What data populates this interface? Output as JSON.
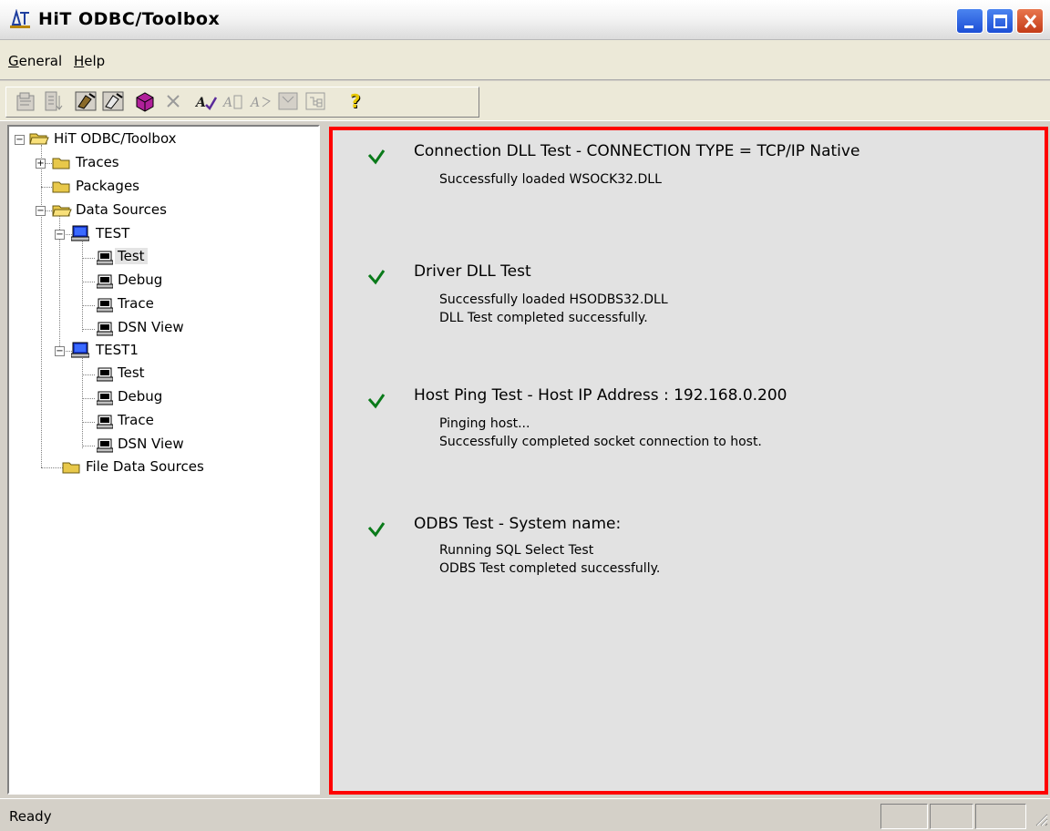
{
  "window": {
    "title": "HiT ODBC/Toolbox"
  },
  "menu": {
    "items": [
      {
        "label_first": "G",
        "label_rest": "eneral"
      },
      {
        "label_first": "H",
        "label_rest": "elp"
      }
    ]
  },
  "toolbar": {
    "buttons": [
      "properties-icon",
      "export-icon",
      "connect-icon",
      "disconnect-icon",
      "package-icon",
      "delete-icon",
      "test-icon",
      "query-icon",
      "trace-icon",
      "debug-icon",
      "tree-view-icon",
      "help-icon"
    ]
  },
  "tree": {
    "root": "HiT ODBC/Toolbox",
    "traces": "Traces",
    "packages": "Packages",
    "data_sources": "Data Sources",
    "dsn1": {
      "name": "TEST",
      "children": [
        "Test",
        "Debug",
        "Trace",
        "DSN View"
      ]
    },
    "dsn2": {
      "name": "TEST1",
      "children": [
        "Test",
        "Debug",
        "Trace",
        "DSN View"
      ]
    },
    "file_data_sources": "File Data Sources",
    "selected": "Test"
  },
  "results": {
    "tests": [
      {
        "title": "Connection DLL Test - CONNECTION TYPE = TCP/IP Native",
        "lines": [
          "Successfully loaded WSOCK32.DLL"
        ]
      },
      {
        "title": "Driver DLL Test",
        "lines": [
          "Successfully loaded HSODBS32.DLL",
          "DLL Test completed successfully."
        ]
      },
      {
        "title": "Host Ping Test - Host IP Address : 192.168.0.200",
        "lines": [
          "Pinging host...",
          "Successfully completed socket connection to host."
        ]
      },
      {
        "title": "ODBS Test - System name:",
        "lines": [
          "Running SQL Select Test",
          "ODBS Test completed successfully."
        ]
      }
    ],
    "check_color": "#007f00",
    "border_color": "#ff0000"
  },
  "status": {
    "text": "Ready"
  }
}
